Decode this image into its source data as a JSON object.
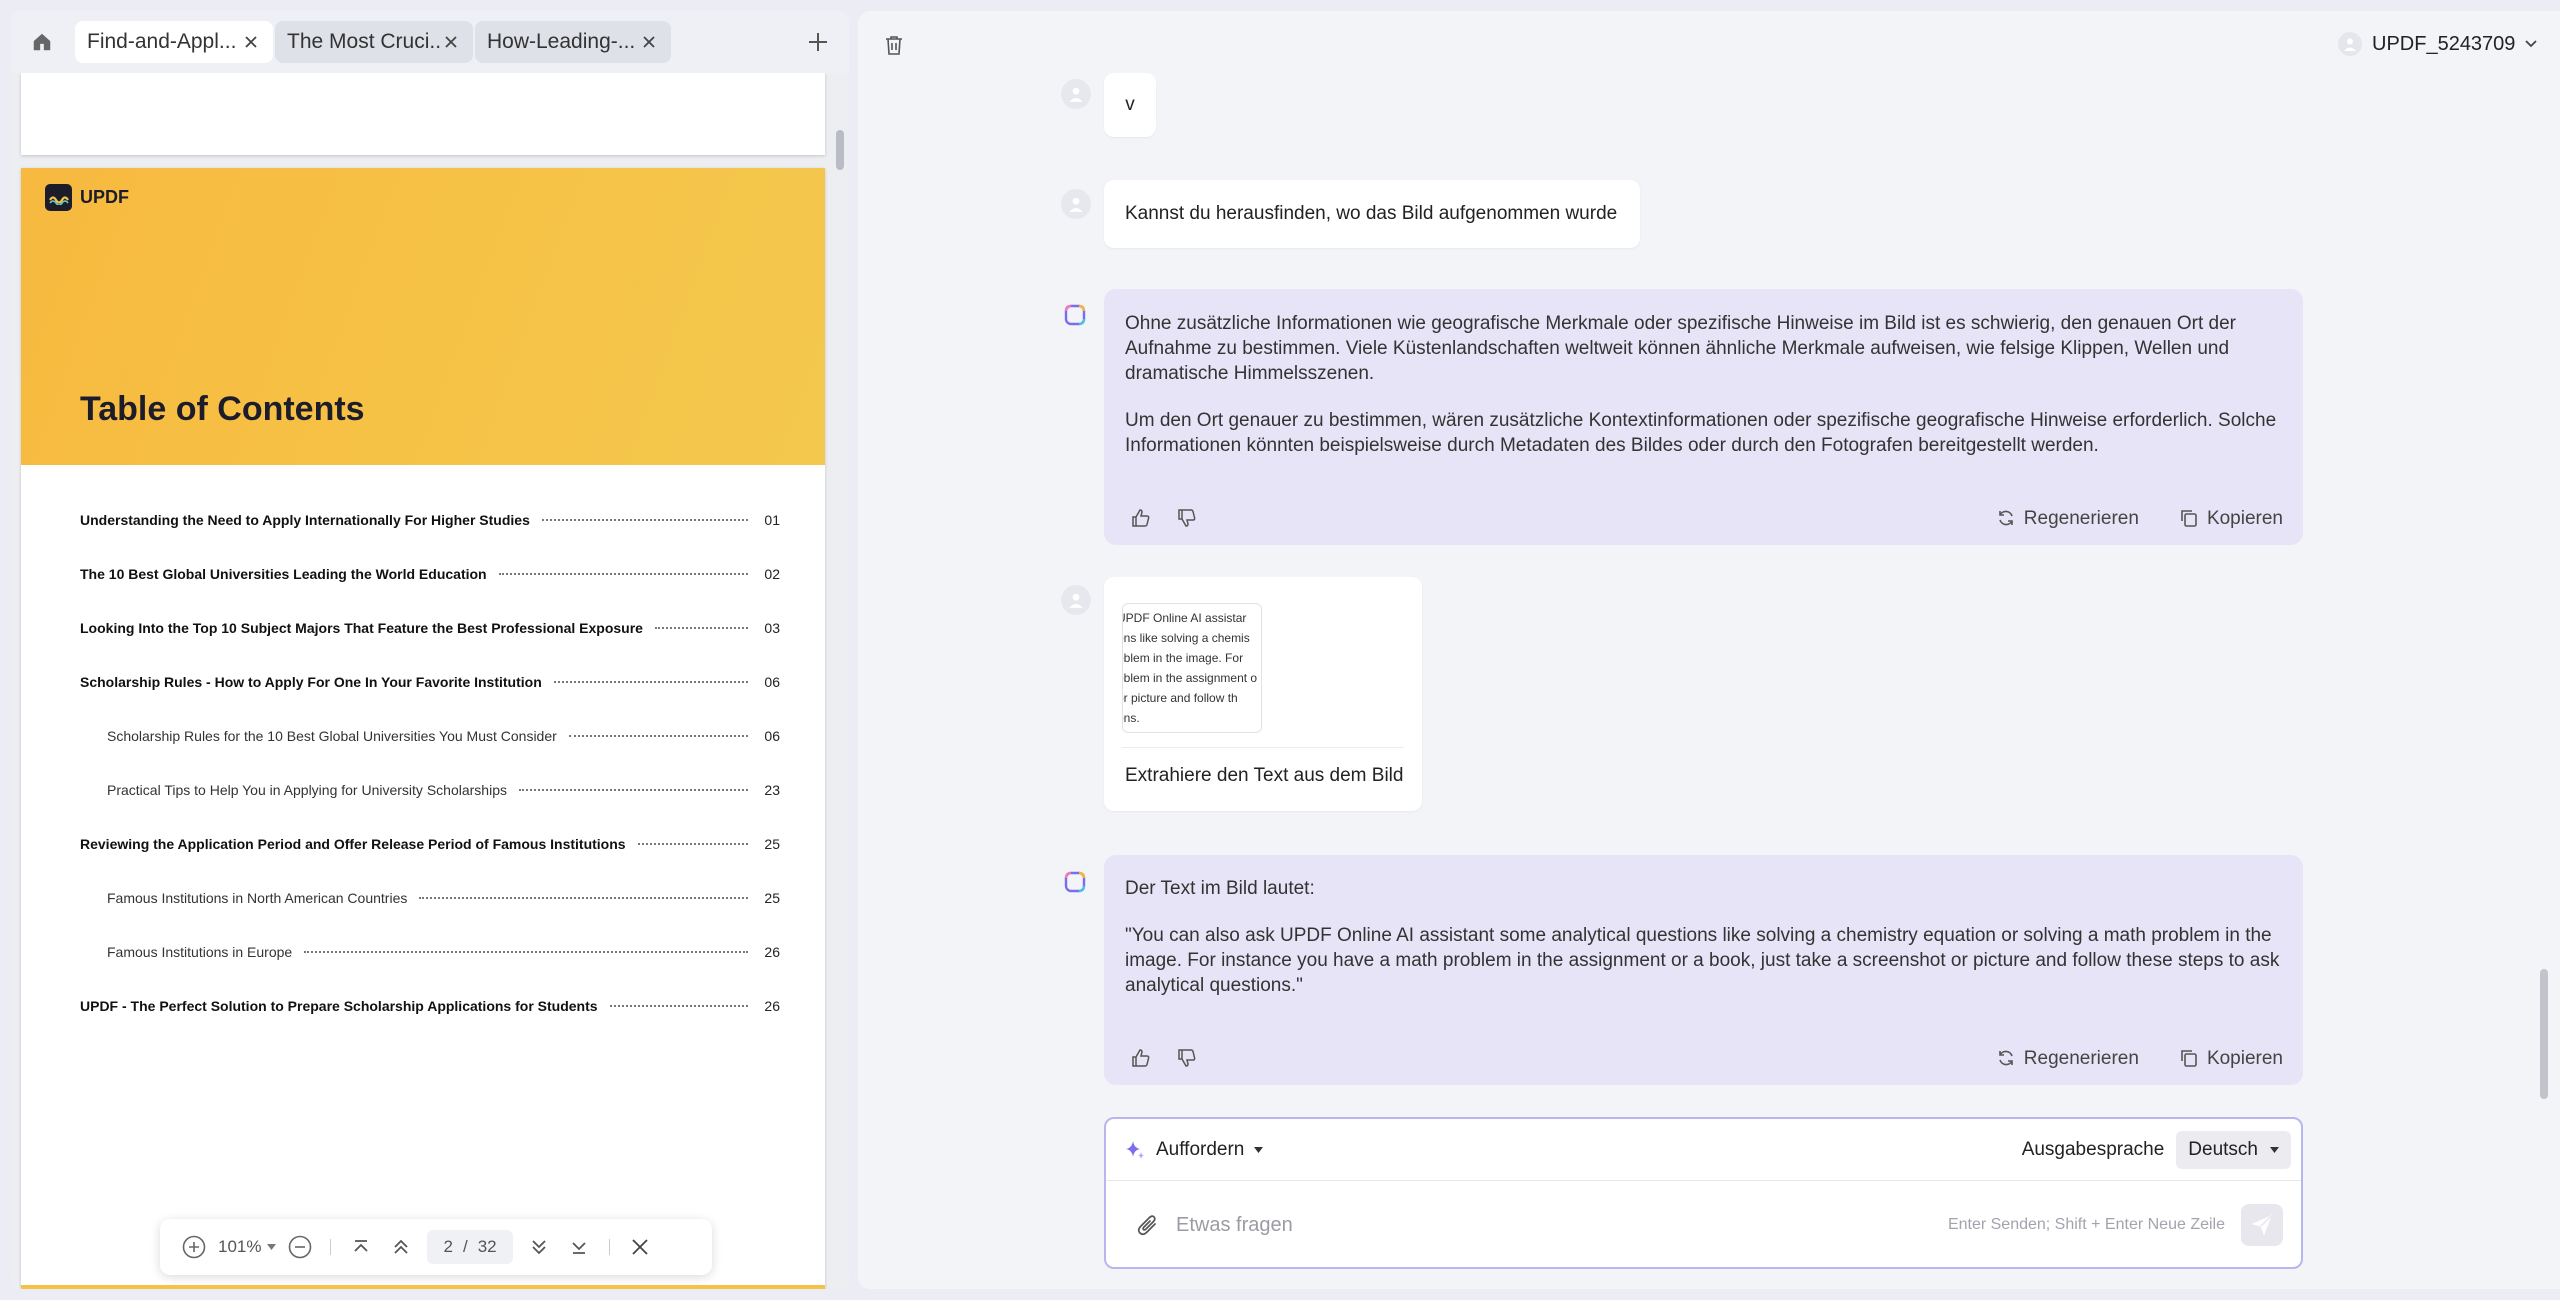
{
  "tabs": [
    {
      "label": "Find-and-Appl..."
    },
    {
      "label": "The Most Cruci..."
    },
    {
      "label": "How-Leading-..."
    }
  ],
  "document": {
    "logo_text": "UPDF",
    "toc_title": "Table of Contents",
    "toc": [
      {
        "title": "Understanding the Need to Apply Internationally For Higher Studies",
        "page": "01"
      },
      {
        "title": "The 10 Best Global Universities Leading the World Education",
        "page": "02"
      },
      {
        "title": "Looking Into the Top 10 Subject Majors That Feature the Best Professional Exposure",
        "page": "03"
      },
      {
        "title": "Scholarship Rules - How to Apply For One In Your Favorite Institution",
        "page": "06"
      },
      {
        "title": "Scholarship Rules for the 10 Best Global Universities You Must Consider",
        "page": "06"
      },
      {
        "title": "Practical Tips to Help You in Applying for University Scholarships",
        "page": "23"
      },
      {
        "title": "Reviewing the Application Period and Offer Release Period of Famous Institutions",
        "page": "25"
      },
      {
        "title": "Famous Institutions in North American Countries",
        "page": "25"
      },
      {
        "title": "Famous Institutions in Europe",
        "page": "26"
      },
      {
        "title": "UPDF - The Perfect Solution to Prepare Scholarship Applications for Students",
        "page": "26"
      }
    ]
  },
  "pdf_toolbar": {
    "zoom": "101%",
    "current_page": "2",
    "separator": "/",
    "total_pages": "32"
  },
  "header": {
    "username": "UPDF_5243709"
  },
  "chat": {
    "msg1": "v",
    "msg2": "Kannst du herausfinden, wo das Bild aufgenommen wurde",
    "ai1_p1": "Ohne zusätzliche Informationen wie geografische Merkmale oder spezifische Hinweise im Bild ist es schwierig, den genauen Ort der Aufnahme zu bestimmen. Viele Küstenlandschaften weltweit können ähnliche Merkmale aufweisen, wie felsige Klippen, Wellen und dramatische Himmelsszenen.",
    "ai1_p2": "Um den Ort genauer zu bestimmen, wären zusätzliche Kontextinformationen oder spezifische geografische Hinweise erforderlich. Solche Informationen könnten beispielsweise durch Metadaten des Bildes oder durch den Fotografen bereitgestellt werden.",
    "thumb_lines": [
      "UPDF Online AI assistar",
      "ons like solving a chemis",
      "oblem in the image. For",
      "oblem in the assignment o",
      "or picture and follow th",
      "ons."
    ],
    "msg3": "Extrahiere den Text aus dem Bild",
    "ai2_p1": "Der Text im Bild lautet:",
    "ai2_p2": "\"You can also ask UPDF Online AI assistant some analytical questions like solving a chemistry equation or solving a math problem in the image. For instance you have a math problem in the assignment or a book, just take a screenshot or picture and follow these steps to ask analytical questions.\"",
    "regenerate": "Regenerieren",
    "copy": "Kopieren"
  },
  "composer": {
    "prompt_label": "Auffordern",
    "output_language_label": "Ausgabesprache",
    "language": "Deutsch",
    "placeholder": "Etwas fragen",
    "hint": "Enter Senden; Shift + Enter Neue Zeile"
  },
  "colors": {
    "ai_bubble": "#e6e4f6",
    "composer_border": "#b9b5ef",
    "banner": "#f6c246"
  }
}
